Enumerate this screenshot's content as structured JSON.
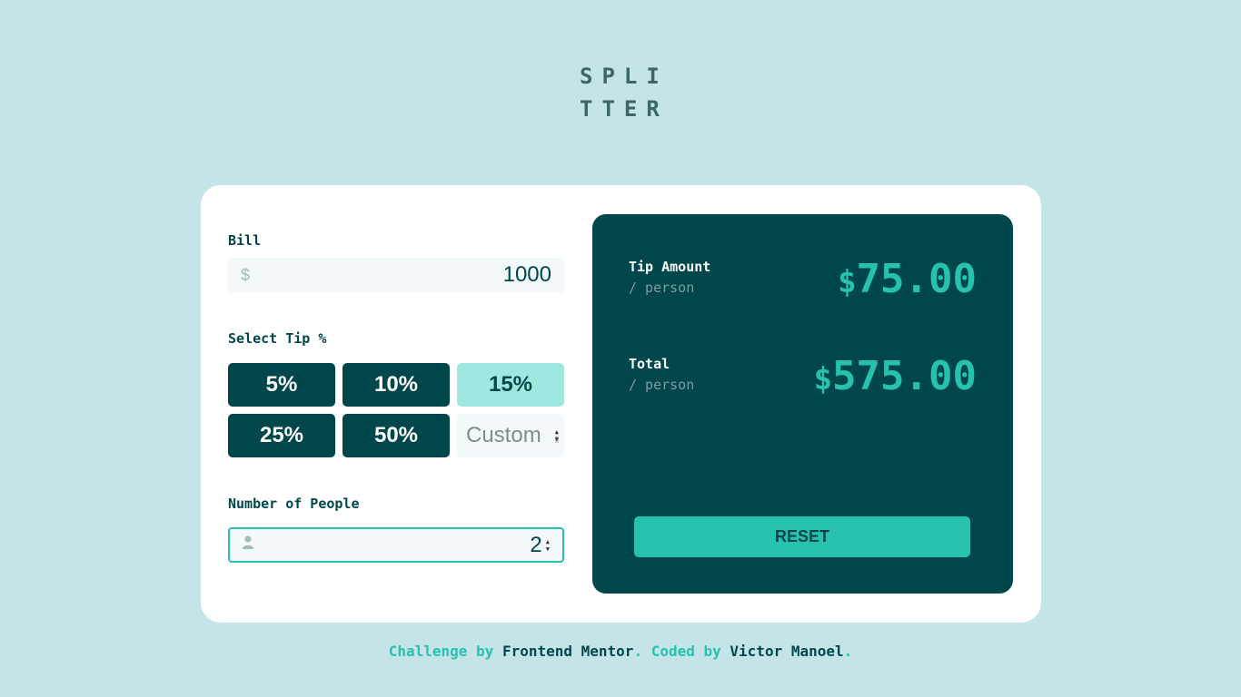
{
  "logo": {
    "line1": "SPLI",
    "line2": "TTER"
  },
  "bill": {
    "label": "Bill",
    "prefix": "$",
    "value": "1000"
  },
  "tip": {
    "label": "Select Tip %",
    "options": [
      "5%",
      "10%",
      "15%",
      "25%",
      "50%"
    ],
    "selected": "15%",
    "custom_placeholder": "Custom"
  },
  "people": {
    "label": "Number of People",
    "value": "2"
  },
  "results": {
    "tip_label": "Tip Amount",
    "tip_sub": "/ person",
    "tip_currency": "$",
    "tip_value": "75.00",
    "total_label": "Total",
    "total_sub": "/ person",
    "total_currency": "$",
    "total_value": "575.00",
    "reset_label": "RESET"
  },
  "footer": {
    "part1": "Challenge by ",
    "link1": "Frontend Mentor",
    "part2": ". Coded by ",
    "link2": "Victor Manoel",
    "part3": "."
  },
  "colors": {
    "background": "#c5e4e7",
    "dark_cyan": "#00474b",
    "strong_cyan": "#26c2ad",
    "light_cyan": "#9fe8df"
  }
}
